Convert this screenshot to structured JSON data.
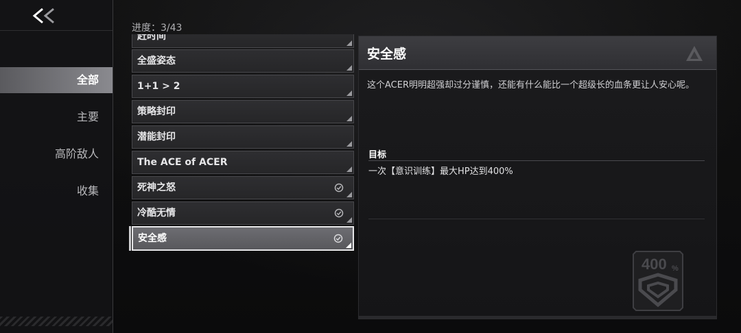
{
  "nav": {
    "back_icon": "double-chevron-left-icon",
    "items": [
      {
        "label": "全部",
        "active": true
      },
      {
        "label": "主要",
        "active": false
      },
      {
        "label": "高阶敌人",
        "active": false
      },
      {
        "label": "收集",
        "active": false
      }
    ]
  },
  "progress": {
    "label": "进度：3/43",
    "current": 3,
    "total": 43
  },
  "achievements": [
    {
      "title": "赶时间",
      "completed": false,
      "selected": false
    },
    {
      "title": "全盛姿态",
      "completed": false,
      "selected": false
    },
    {
      "title": "1+1 > 2",
      "completed": false,
      "selected": false
    },
    {
      "title": "策略封印",
      "completed": false,
      "selected": false
    },
    {
      "title": "潜能封印",
      "completed": false,
      "selected": false
    },
    {
      "title": "The ACE of ACER",
      "completed": false,
      "selected": false
    },
    {
      "title": "死神之怒",
      "completed": true,
      "selected": false
    },
    {
      "title": "冷酷无情",
      "completed": true,
      "selected": false
    },
    {
      "title": "安全感",
      "completed": true,
      "selected": true
    }
  ],
  "detail": {
    "title": "安全感",
    "description": "这个ACER明明超强却过分谨慎，还能有什么能比一个超级长的血条更让人安心呢。",
    "goal_label": "目标",
    "goal_text": "一次【意识训练】最大HP达到400%",
    "badge_text": "400",
    "badge_unit": "%"
  },
  "colors": {
    "accent": "#e6e6e8",
    "check": "#b5b5b8",
    "background": "#0d0d0e"
  }
}
